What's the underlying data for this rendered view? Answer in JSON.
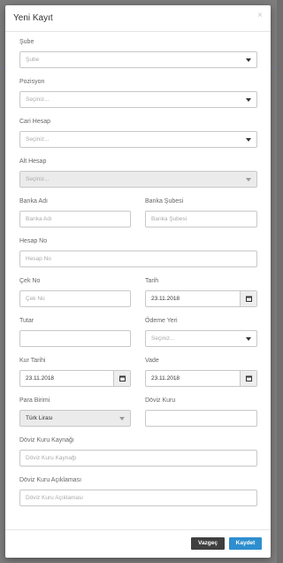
{
  "modal": {
    "title": "Yeni Kayıt",
    "close_symbol": "×"
  },
  "fields": {
    "sube": {
      "label": "Şube",
      "placeholder": "Şube"
    },
    "pozisyon": {
      "label": "Pozisyon",
      "placeholder": "Seçiniz..."
    },
    "cari_hesap": {
      "label": "Cari Hesap",
      "placeholder": "Seçiniz..."
    },
    "alt_hesap": {
      "label": "Alt Hesap",
      "placeholder": "Seçiniz..."
    },
    "banka_adi": {
      "label": "Banka Adı",
      "placeholder": "Banka Adı"
    },
    "banka_subesi": {
      "label": "Banka Şubesi",
      "placeholder": "Banka Şubesi"
    },
    "hesap_no": {
      "label": "Hesap No",
      "placeholder": "Hesap No"
    },
    "cek_no": {
      "label": "Çek No",
      "placeholder": "Çek No"
    },
    "tarih": {
      "label": "Tarih",
      "value": "23.11.2018"
    },
    "tutar": {
      "label": "Tutar",
      "value": ""
    },
    "odeme_yeri": {
      "label": "Ödeme Yeri",
      "placeholder": "Seçiniz..."
    },
    "kur_tarihi": {
      "label": "Kur Tarihi",
      "value": "23.11.2018"
    },
    "vade": {
      "label": "Vade",
      "value": "23.11.2018"
    },
    "para_birimi": {
      "label": "Para Birimi",
      "value": "Türk Lirası"
    },
    "doviz_kuru": {
      "label": "Döviz Kuru",
      "value": ""
    },
    "doviz_kuru_kaynagi": {
      "label": "Döviz Kuru Kaynağı",
      "placeholder": "Döviz Kuru Kaynağı"
    },
    "doviz_kuru_aciklamasi": {
      "label": "Döviz Kuru Açıklaması",
      "placeholder": "Döviz Kuru Açıklaması"
    }
  },
  "buttons": {
    "cancel": "Vazgeç",
    "save": "Kaydet"
  },
  "icons": {
    "calendar": "calendar-icon",
    "dropdown": "chevron-down-icon"
  },
  "colors": {
    "save": "#2e8ecf",
    "cancel": "#3f3f3f"
  }
}
